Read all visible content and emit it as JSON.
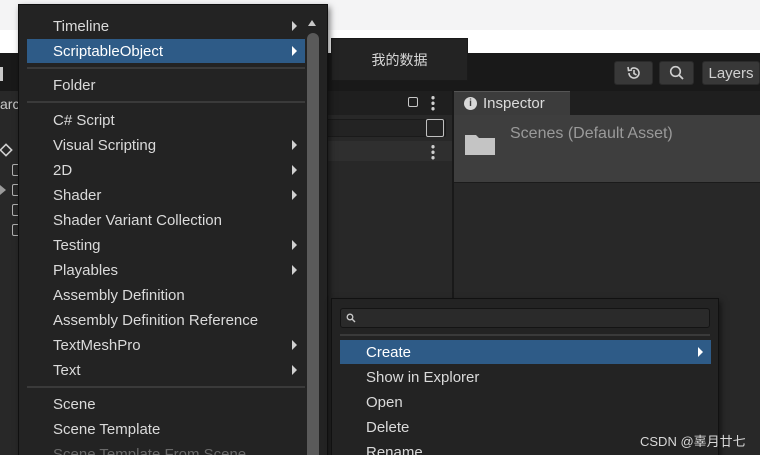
{
  "toolbar": {
    "history_icon": "history-icon",
    "search_icon": "search-icon",
    "layers_label": "Layers"
  },
  "hierarchy": {
    "title_fragment": "arc"
  },
  "popup": {
    "label": "我的数据"
  },
  "inspector": {
    "tab_label": "Inspector",
    "asset_title": "Scenes (Default Asset)"
  },
  "create_menu": {
    "items": [
      {
        "label": "Timeline",
        "submenu": true
      },
      {
        "label": "ScriptableObject",
        "submenu": true,
        "selected": true
      },
      {
        "label": "Folder",
        "submenu": false
      },
      {
        "label": "C# Script",
        "submenu": false
      },
      {
        "label": "Visual Scripting",
        "submenu": true
      },
      {
        "label": "2D",
        "submenu": true
      },
      {
        "label": "Shader",
        "submenu": true
      },
      {
        "label": "Shader Variant Collection",
        "submenu": false
      },
      {
        "label": "Testing",
        "submenu": true
      },
      {
        "label": "Playables",
        "submenu": true
      },
      {
        "label": "Assembly Definition",
        "submenu": false
      },
      {
        "label": "Assembly Definition Reference",
        "submenu": false
      },
      {
        "label": "TextMeshPro",
        "submenu": true
      },
      {
        "label": "Text",
        "submenu": true
      },
      {
        "label": "Scene",
        "submenu": false
      },
      {
        "label": "Scene Template",
        "submenu": false
      },
      {
        "label": "Scene Template From Scene",
        "submenu": false
      }
    ]
  },
  "context_menu": {
    "search_placeholder": "",
    "items": [
      {
        "label": "Create",
        "submenu": true,
        "selected": true
      },
      {
        "label": "Show in Explorer"
      },
      {
        "label": "Open"
      },
      {
        "label": "Delete"
      },
      {
        "label": "Rename"
      }
    ]
  },
  "watermark": "CSDN @辜月廿七",
  "colors": {
    "selection": "#2e5b87",
    "menu_bg": "#232323",
    "editor_bg": "#191919"
  }
}
